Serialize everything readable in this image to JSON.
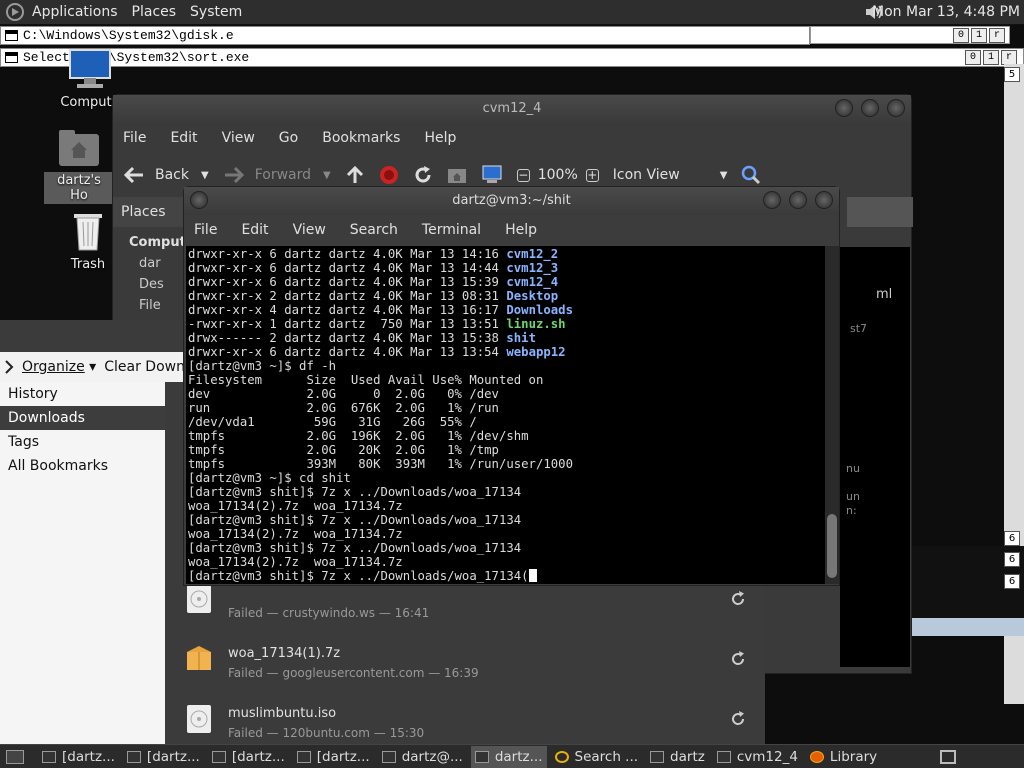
{
  "top_panel": {
    "menus": [
      "Applications",
      "Places",
      "System"
    ],
    "clock": "Mon Mar 13,  4:48 PM"
  },
  "cmd_windows": [
    {
      "title": "C:\\Windows\\System32\\gdisk.e"
    },
    {
      "title": "Select        dows\\System32\\sort.exe"
    }
  ],
  "cmd_controls": [
    "0",
    "1",
    "r"
  ],
  "side_numbers": [
    "5",
    "6",
    "6",
    "6"
  ],
  "desktop": {
    "icons": [
      {
        "label": "Compute"
      },
      {
        "label": "dartz's Ho"
      },
      {
        "label": "Trash"
      }
    ]
  },
  "nautilus": {
    "title": "cvm12_4",
    "menu": [
      "File",
      "Edit",
      "View",
      "Go",
      "Bookmarks",
      "Help"
    ],
    "toolbar": {
      "back": "Back",
      "forward": "Forward",
      "zoom": "100%",
      "view_mode": "Icon View"
    },
    "places_label": "Places",
    "sidebar": {
      "heading": "Compute",
      "items": [
        "dar",
        "Des",
        "File"
      ]
    },
    "right_fragments": [
      "ml",
      "st7",
      "nu",
      "un",
      "n:"
    ]
  },
  "terminal": {
    "title": "dartz@vm3:~/shit",
    "menu": [
      "File",
      "Edit",
      "View",
      "Search",
      "Terminal",
      "Help"
    ],
    "lines": [
      {
        "text": "drwxr-xr-x 6 dartz dartz 4.0K Mar 13 14:16 ",
        "name": "cvm12_2",
        "kind": "dir"
      },
      {
        "text": "drwxr-xr-x 6 dartz dartz 4.0K Mar 13 14:44 ",
        "name": "cvm12_3",
        "kind": "dir"
      },
      {
        "text": "drwxr-xr-x 6 dartz dartz 4.0K Mar 13 15:39 ",
        "name": "cvm12_4",
        "kind": "dir"
      },
      {
        "text": "drwxr-xr-x 2 dartz dartz 4.0K Mar 13 08:31 ",
        "name": "Desktop",
        "kind": "dir"
      },
      {
        "text": "drwxr-xr-x 4 dartz dartz 4.0K Mar 13 16:17 ",
        "name": "Downloads",
        "kind": "dir"
      },
      {
        "text": "-rwxr-xr-x 1 dartz dartz  750 Mar 13 13:51 ",
        "name": "linuz.sh",
        "kind": "exec"
      },
      {
        "text": "drwx------ 2 dartz dartz 4.0K Mar 13 15:38 ",
        "name": "shit",
        "kind": "dir"
      },
      {
        "text": "drwxr-xr-x 6 dartz dartz 4.0K Mar 13 13:54 ",
        "name": "webapp12",
        "kind": "dir"
      },
      {
        "text": "[dartz@vm3 ~]$ df -h"
      },
      {
        "text": "Filesystem      Size  Used Avail Use% Mounted on"
      },
      {
        "text": "dev             2.0G     0  2.0G   0% /dev"
      },
      {
        "text": "run             2.0G  676K  2.0G   1% /run"
      },
      {
        "text": "/dev/vda1        59G   31G   26G  55% /"
      },
      {
        "text": "tmpfs           2.0G  196K  2.0G   1% /dev/shm"
      },
      {
        "text": "tmpfs           2.0G   20K  2.0G   1% /tmp"
      },
      {
        "text": "tmpfs           393M   80K  393M   1% /run/user/1000"
      },
      {
        "text": "[dartz@vm3 ~]$ cd shit"
      },
      {
        "text": "[dartz@vm3 shit]$ 7z x ../Downloads/woa_17134"
      },
      {
        "text": "woa_17134(2).7z  woa_17134.7z"
      },
      {
        "text": "[dartz@vm3 shit]$ 7z x ../Downloads/woa_17134"
      },
      {
        "text": "woa_17134(2).7z  woa_17134.7z"
      },
      {
        "text": "[dartz@vm3 shit]$ 7z x ../Downloads/woa_17134"
      },
      {
        "text": "woa_17134(2).7z  woa_17134.7z"
      },
      {
        "text": "[dartz@vm3 shit]$ 7z x ../Downloads/woa_17134(",
        "cursor": true
      }
    ]
  },
  "library": {
    "organize": "Organize",
    "clear": "Clear Download",
    "sidebar": [
      "History",
      "Downloads",
      "Tags",
      "All Bookmarks"
    ],
    "selected": 1,
    "downloads": [
      {
        "name": "",
        "status": "Failed — crustywindo.ws — 16:41",
        "icon": "disc-icon"
      },
      {
        "name": "woa_17134(1).7z",
        "status": "Failed — googleusercontent.com — 16:39",
        "icon": "archive-icon"
      },
      {
        "name": "muslimbuntu.iso",
        "status": "Failed — 120buntu.com — 15:30",
        "icon": "disc-icon"
      }
    ]
  },
  "taskbar": {
    "items": [
      {
        "label": "[dartz..."
      },
      {
        "label": "[dartz..."
      },
      {
        "label": "[dartz..."
      },
      {
        "label": "[dartz..."
      },
      {
        "label": "dartz@..."
      },
      {
        "label": "dartz...",
        "active": true
      },
      {
        "label": "Search ..."
      },
      {
        "label": "dartz"
      },
      {
        "label": "cvm12_4"
      },
      {
        "label": "Library"
      }
    ]
  }
}
